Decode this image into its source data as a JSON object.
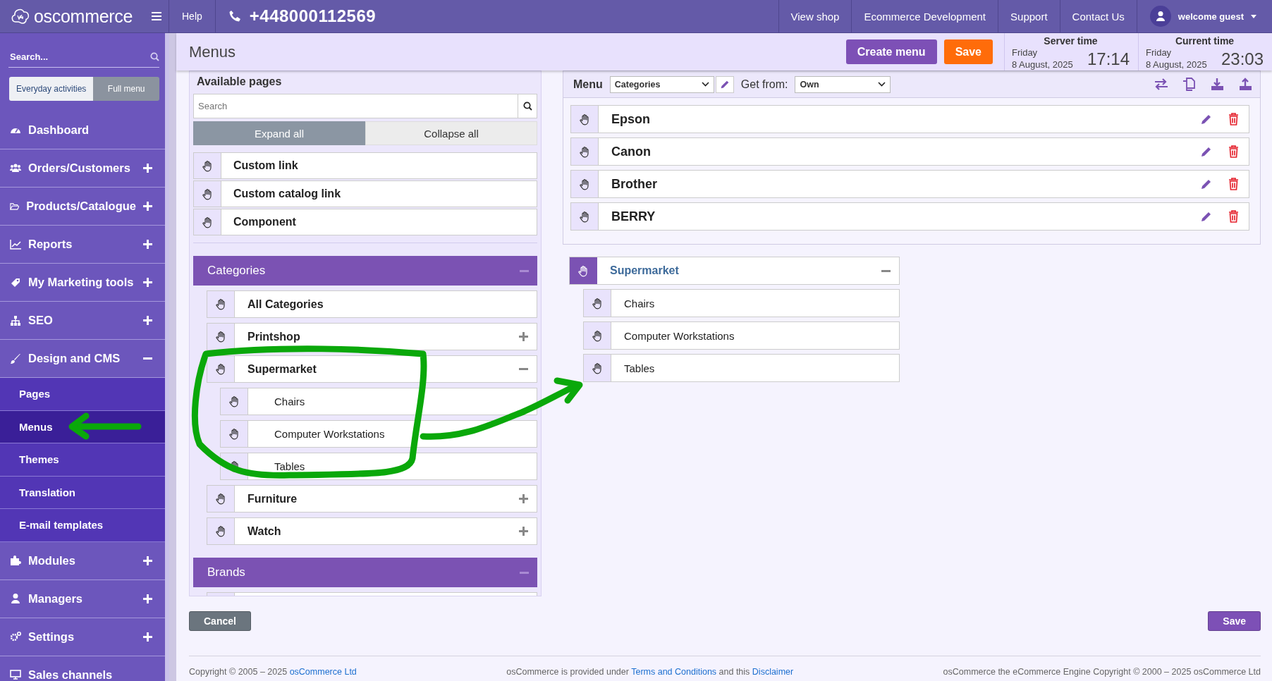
{
  "topbar": {
    "logo": "oscommerce",
    "help": "Help",
    "phone": "+448000112569",
    "links": [
      "View shop",
      "Ecommerce Development",
      "Support",
      "Contact Us"
    ],
    "user": "welcome guest"
  },
  "sidebar": {
    "search_placeholder": "Search...",
    "modes": [
      {
        "label": "Everyday activities",
        "selected": false
      },
      {
        "label": "Full menu",
        "selected": true
      }
    ],
    "items": [
      {
        "label": "Dashboard"
      },
      {
        "label": "Orders/Customers",
        "expanded": false
      },
      {
        "label": "Products/Catalogue",
        "expanded": false
      },
      {
        "label": "Reports",
        "expanded": false
      },
      {
        "label": "My Marketing tools",
        "expanded": false
      },
      {
        "label": "SEO",
        "expanded": false
      },
      {
        "label": "Design and CMS",
        "expanded": true,
        "children": [
          {
            "label": "Pages",
            "selected": false
          },
          {
            "label": "Menus",
            "selected": true
          },
          {
            "label": "Themes",
            "selected": false
          },
          {
            "label": "Translation",
            "selected": false
          },
          {
            "label": "E-mail templates",
            "selected": false
          }
        ]
      },
      {
        "label": "Modules",
        "expanded": false
      },
      {
        "label": "Managers",
        "expanded": false
      },
      {
        "label": "Settings",
        "expanded": false
      },
      {
        "label": "Sales channels"
      }
    ]
  },
  "header": {
    "title": "Menus",
    "buttons": [
      {
        "label": "Create menu",
        "kind": "primary"
      },
      {
        "label": "Save",
        "kind": "warning"
      }
    ],
    "clocks": [
      {
        "label": "Server time",
        "day": "Friday",
        "date": "8 August, 2025",
        "time": "17:14"
      },
      {
        "label": "Current time",
        "day": "Friday",
        "date": "8 August, 2025",
        "time": "23:03"
      }
    ]
  },
  "pages": {
    "title": "Available pages",
    "search_placeholder": "Search",
    "expand_buttons": [
      {
        "label": "Expand all",
        "selected": true
      },
      {
        "label": "Collapse all",
        "selected": false
      }
    ],
    "links": [
      "Custom link",
      "Custom catalog link",
      "Component"
    ],
    "groups": [
      {
        "title": "Categories",
        "expanded": true,
        "items": [
          {
            "label": "All Categories"
          },
          {
            "label": "Printshop",
            "expanded": false
          },
          {
            "label": "Supermarket",
            "expanded": true,
            "children": [
              "Chairs",
              "Computer Workstations",
              "Tables"
            ]
          },
          {
            "label": "Furniture",
            "expanded": false
          },
          {
            "label": "Watch",
            "expanded": false
          }
        ]
      },
      {
        "title": "Brands",
        "expanded": true
      }
    ]
  },
  "menu": {
    "label": "Menu",
    "menu_select": "Categories",
    "get_from_label": "Get from:",
    "get_from_select": "Own",
    "items": [
      "Epson",
      "Canon",
      "Brother",
      "BERRY"
    ],
    "tree": [
      {
        "label": "Supermarket",
        "selected": true,
        "expanded": true,
        "children": [
          {
            "label": "Chairs",
            "selected": false
          },
          {
            "label": "Computer Workstations",
            "selected": false
          },
          {
            "label": "Tables",
            "selected": false
          }
        ]
      }
    ]
  },
  "footer": {
    "buttons": [
      {
        "label": "Cancel",
        "kind": "cancel"
      },
      {
        "label": "Save",
        "kind": "primary"
      }
    ],
    "notes": [
      [
        {
          "kind": "text",
          "text": "Copyright © 2005 – 2025"
        },
        {
          "kind": "link",
          "text": "osCommerce Ltd"
        }
      ],
      [
        {
          "kind": "text",
          "text": "osCommerce is provided under"
        },
        {
          "kind": "link",
          "text": "Terms and Conditions"
        },
        {
          "kind": "text",
          "text": "and this"
        },
        {
          "kind": "link",
          "text": "Disclaimer"
        }
      ],
      [
        {
          "kind": "text",
          "text": "osCommerce the eCommerce Engine Copyright © 2000 – 2025 osCommerce Ltd"
        }
      ]
    ]
  }
}
